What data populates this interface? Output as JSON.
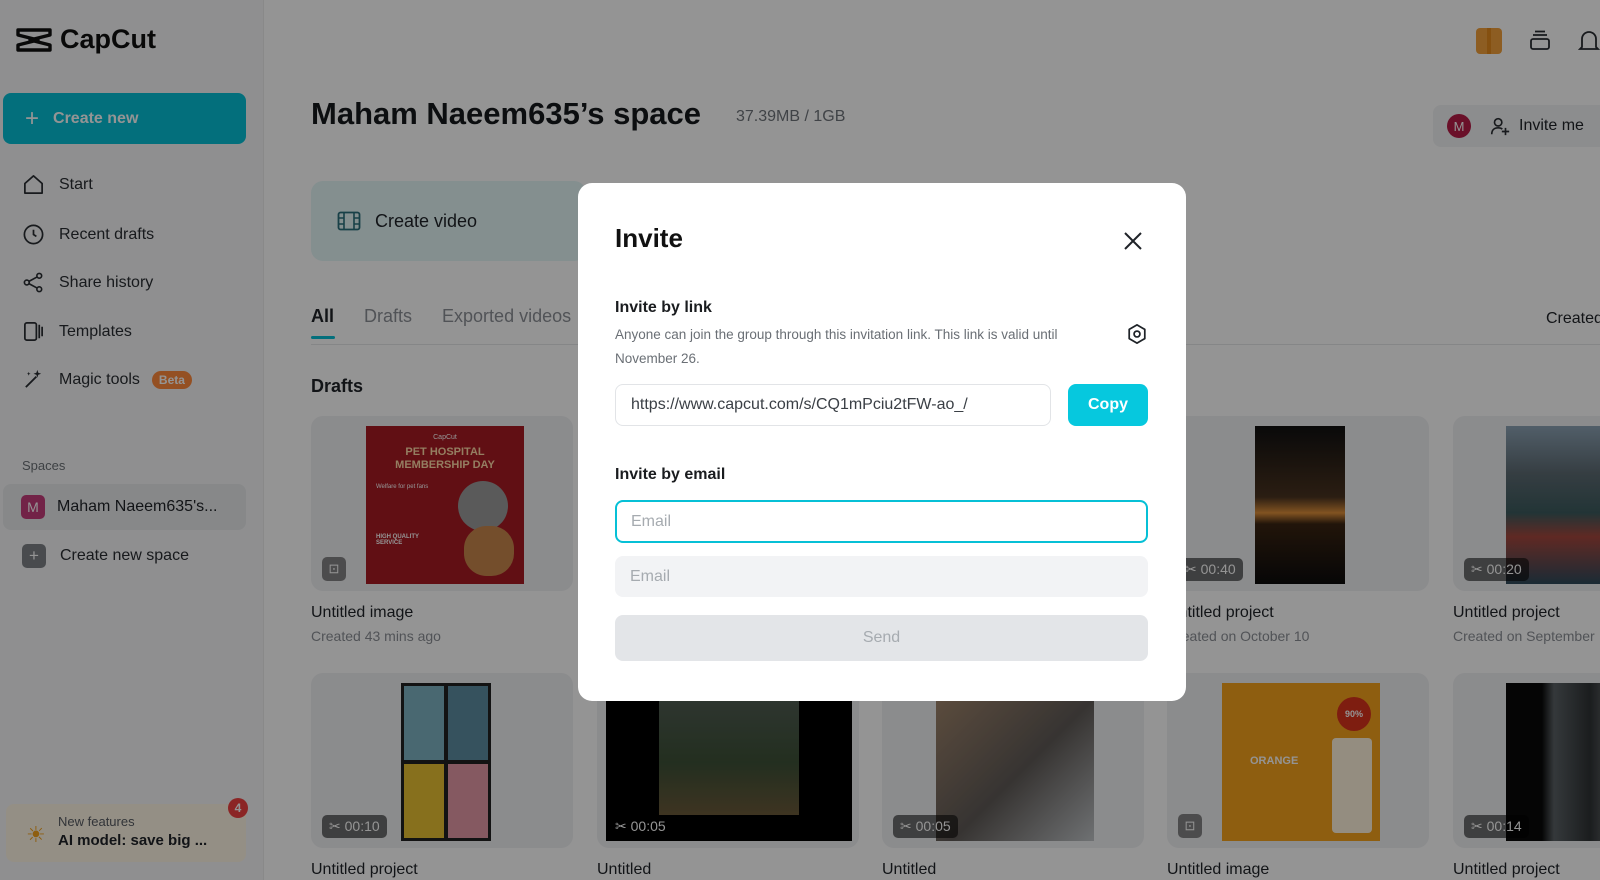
{
  "app": {
    "name": "CapCut"
  },
  "sidebar": {
    "create_new": "Create new",
    "items": [
      {
        "label": "Start",
        "icon": "home-icon"
      },
      {
        "label": "Recent drafts",
        "icon": "clock-icon"
      },
      {
        "label": "Share history",
        "icon": "share-icon"
      },
      {
        "label": "Templates",
        "icon": "templates-icon"
      },
      {
        "label": "Magic tools",
        "icon": "magic-wand-icon",
        "badge": "Beta"
      }
    ],
    "spaces_label": "Spaces",
    "current_space": {
      "avatar": "M",
      "label": "Maham Naeem635's..."
    },
    "new_space": "Create new space",
    "new_features": {
      "title": "New features",
      "text": "AI model: save big ...",
      "count": "4"
    }
  },
  "header": {
    "space_title": "Maham Naeem635’s space",
    "storage": "37.39MB / 1GB",
    "invite_avatar": "M",
    "invite_label": "Invite me"
  },
  "main": {
    "create_video": "Create video",
    "tabs": [
      "All",
      "Drafts",
      "Exported videos"
    ],
    "sort_label": "Created",
    "section_title": "Drafts",
    "cards": [
      {
        "name": "Untitled image",
        "date": "Created 43 mins ago",
        "badge": ""
      },
      {
        "name": "Untitled project",
        "date": "Created on October 10",
        "badge": "00:40"
      },
      {
        "name": "Untitled project",
        "date": "Created on September",
        "badge": "00:20"
      },
      {
        "name": "Untitled project",
        "badge": "00:10"
      },
      {
        "name": "Untitled",
        "badge": "00:05"
      },
      {
        "name": "Untitled",
        "badge": "00:05"
      },
      {
        "name": "Untitled image",
        "badge": ""
      },
      {
        "name": "Untitled project",
        "badge": "00:14"
      }
    ],
    "poster_text": {
      "brand": "CapCut",
      "headline": "PET HOSPITAL MEMBERSHIP DAY",
      "sub": "Welfare for pet fans",
      "service": "HIGH QUALITY SERVICE"
    },
    "orange_poster": {
      "pct": "90%",
      "word": "ORANGE"
    }
  },
  "modal": {
    "title": "Invite",
    "link_section": "Invite by link",
    "link_desc": "Anyone can join the group through this invitation link. This link is valid until November 26.",
    "link_url": "https://www.capcut.com/s/CQ1mPciu2tFW-ao_/",
    "copy_label": "Copy",
    "email_section": "Invite by email",
    "email_placeholder": "Email",
    "send_label": "Send"
  },
  "colors": {
    "accent": "#06c0d6",
    "beta": "#ff8a3d",
    "badge": "#ef4040"
  }
}
